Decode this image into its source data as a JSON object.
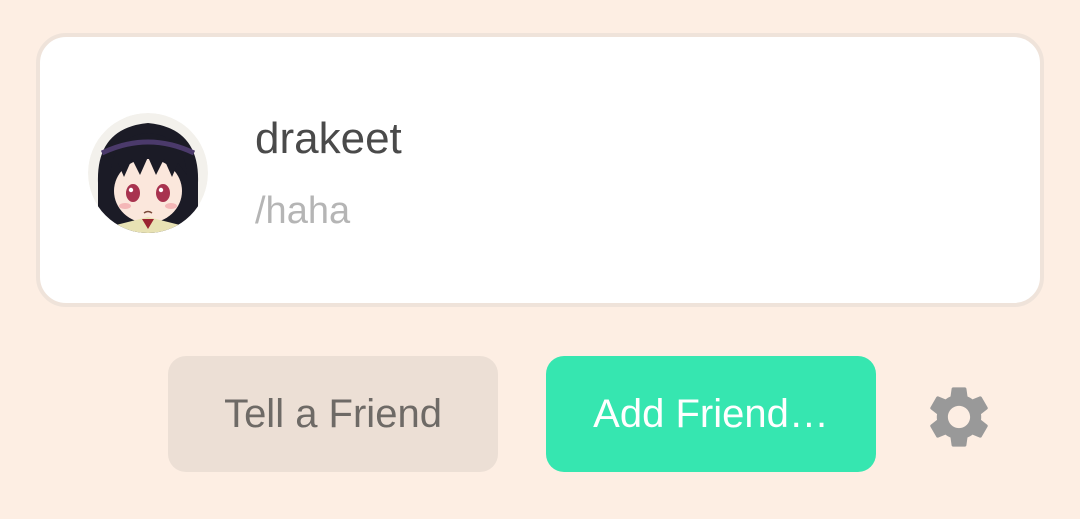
{
  "profile": {
    "username": "drakeet",
    "handle": "/haha",
    "avatar": "anime-girl-avatar"
  },
  "actions": {
    "tell_friend_label": "Tell a Friend",
    "add_friend_label": "Add Friend…",
    "settings_icon": "gear-icon"
  },
  "colors": {
    "background": "#fdeee3",
    "accent": "#36e6b0",
    "secondary_button": "#ecdfd5",
    "icon": "#999999"
  }
}
